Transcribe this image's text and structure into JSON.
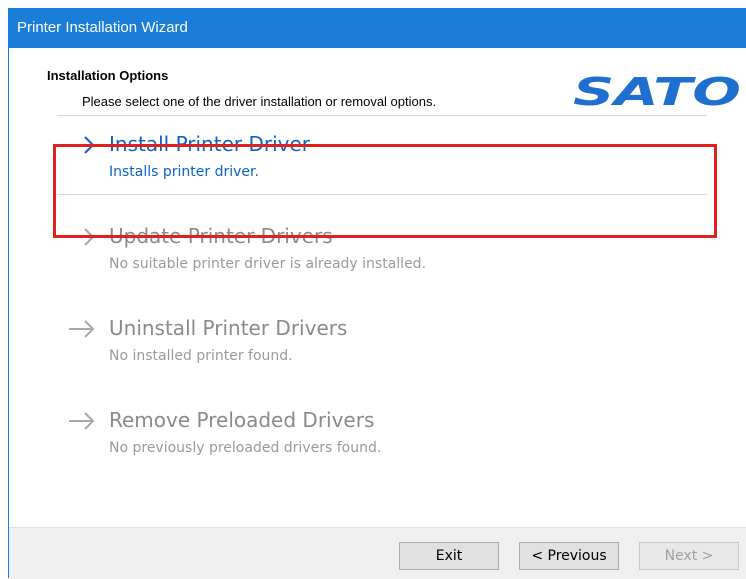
{
  "window": {
    "title": "Printer Installation Wizard"
  },
  "header": {
    "section_title": "Installation Options",
    "section_desc": "Please select one of the driver installation or removal options.",
    "logo_text": "SATO"
  },
  "options": [
    {
      "label": "Install Printer Driver",
      "desc": "Installs printer driver.",
      "state": "enabled",
      "selected": true,
      "icon": "arrow-right-icon"
    },
    {
      "label": "Update Printer Drivers",
      "desc": "No suitable printer driver is already installed.",
      "state": "disabled",
      "selected": false,
      "icon": "arrow-right-icon"
    },
    {
      "label": "Uninstall Printer Drivers",
      "desc": "No installed printer found.",
      "state": "disabled",
      "selected": false,
      "icon": "arrow-right-icon"
    },
    {
      "label": "Remove Preloaded Drivers",
      "desc": "No previously preloaded drivers found.",
      "state": "disabled",
      "selected": false,
      "icon": "arrow-right-icon"
    }
  ],
  "footer": {
    "exit_label": "Exit",
    "previous_label": "< Previous",
    "next_label": "Next >"
  },
  "colors": {
    "titlebar": "#1a7dd7",
    "link": "#0a64c8",
    "disabled": "#9a9a9a",
    "highlight": "#e0211f",
    "logo": "#1f6fd1"
  }
}
